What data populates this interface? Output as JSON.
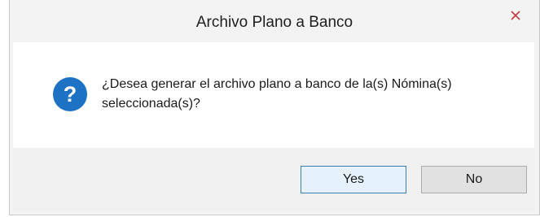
{
  "dialog": {
    "title": "Archivo Plano a Banco",
    "message": "¿Desea generar el archivo plano a banco de la(s) Nómina(s) seleccionada(s)?",
    "icon": "question-icon",
    "buttons": {
      "yes_label": "Yes",
      "no_label": "No"
    },
    "close_icon": "close-icon"
  },
  "colors": {
    "icon_blue": "#1d72c4",
    "close_glyph": "#c7343b",
    "default_button_border": "#3c7fb1"
  }
}
